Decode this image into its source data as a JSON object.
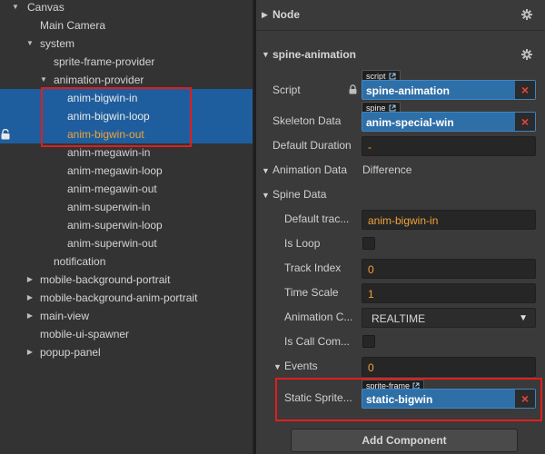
{
  "hierarchy": {
    "rows": [
      {
        "label": "Canvas",
        "arrow": "▼"
      },
      {
        "label": "Main Camera",
        "arrow": ""
      },
      {
        "label": "system",
        "arrow": "▼"
      },
      {
        "label": "sprite-frame-provider",
        "arrow": ""
      },
      {
        "label": "animation-provider",
        "arrow": "▼"
      },
      {
        "label": "anim-bigwin-in",
        "arrow": ""
      },
      {
        "label": "anim-bigwin-loop",
        "arrow": ""
      },
      {
        "label": "anim-bigwin-out",
        "arrow": ""
      },
      {
        "label": "anim-megawin-in",
        "arrow": ""
      },
      {
        "label": "anim-megawin-loop",
        "arrow": ""
      },
      {
        "label": "anim-megawin-out",
        "arrow": ""
      },
      {
        "label": "anim-superwin-in",
        "arrow": ""
      },
      {
        "label": "anim-superwin-loop",
        "arrow": ""
      },
      {
        "label": "anim-superwin-out",
        "arrow": ""
      },
      {
        "label": "notification",
        "arrow": ""
      },
      {
        "label": "mobile-background-portrait",
        "arrow": "▶"
      },
      {
        "label": "mobile-background-anim-portrait",
        "arrow": "▶"
      },
      {
        "label": "main-view",
        "arrow": "▶"
      },
      {
        "label": "mobile-ui-spawner",
        "arrow": ""
      },
      {
        "label": "popup-panel",
        "arrow": "▶"
      }
    ]
  },
  "inspector": {
    "node_section": {
      "title": "Node",
      "arrow": "▶"
    },
    "spine_section": {
      "title": "spine-animation",
      "arrow": "▼"
    },
    "script": {
      "label": "Script",
      "tag": "script",
      "value": "spine-animation",
      "clear": "×"
    },
    "skeleton": {
      "label": "Skeleton Data",
      "tag": "spine",
      "value": "anim-special-win",
      "clear": "×"
    },
    "default_duration": {
      "label": "Default Duration",
      "value": "-"
    },
    "animation_data": {
      "label": "Animation Data",
      "arrow": "▼",
      "value": "Difference"
    },
    "spine_data": {
      "label": "Spine Data",
      "arrow": "▼"
    },
    "default_track": {
      "label": "Default trac...",
      "value": "anim-bigwin-in"
    },
    "is_loop": {
      "label": "Is Loop",
      "checked": false
    },
    "track_index": {
      "label": "Track Index",
      "value": "0"
    },
    "time_scale": {
      "label": "Time Scale",
      "value": "1"
    },
    "animation_callback": {
      "label": "Animation C...",
      "value": "REALTIME",
      "caret": "▼"
    },
    "is_call_complete": {
      "label": "Is Call Com...",
      "checked": false
    },
    "events": {
      "label": "Events",
      "arrow": "▼",
      "value": "0"
    },
    "static_sprite": {
      "label": "Static Sprite...",
      "tag": "sprite-frame",
      "value": "static-bigwin",
      "clear": "×"
    },
    "add_component_label": "Add Component"
  },
  "colors": {
    "selection": "#1f5e9e",
    "active_text": "#f0a33a",
    "highlight_box": "#e01e1e",
    "ref_field": "#2f6fa8",
    "clear_x": "#e54545"
  },
  "icons": [
    "lock-icon",
    "gear-icon",
    "external-link-icon",
    "chevron-down-icon",
    "triangle-right-icon"
  ]
}
